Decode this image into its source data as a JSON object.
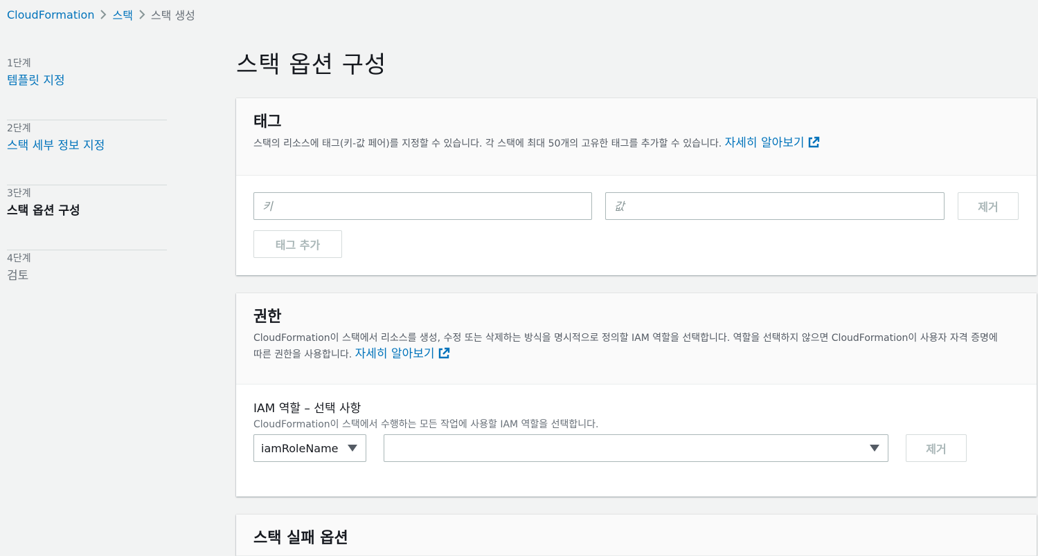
{
  "breadcrumb": {
    "items": [
      "CloudFormation",
      "스택",
      "스택 생성"
    ]
  },
  "steps": [
    {
      "num": "1단계",
      "label": "템플릿 지정"
    },
    {
      "num": "2단계",
      "label": "스택 세부 정보 지정"
    },
    {
      "num": "3단계",
      "label": "스택 옵션 구성"
    },
    {
      "num": "4단계",
      "label": "검토"
    }
  ],
  "page_title": "스택 옵션 구성",
  "tags_panel": {
    "title": "태그",
    "description": "스택의 리소스에 태그(키-값 페어)를 지정할 수 있습니다. 각 스택에 최대 50개의 고유한 태그를 추가할 수 있습니다.",
    "learn_more": "자세히 알아보기",
    "key_placeholder": "키",
    "value_placeholder": "값",
    "remove_label": "제거",
    "add_tag_label": "태그 추가"
  },
  "permissions_panel": {
    "title": "권한",
    "description": "CloudFormation이 스택에서 리소스를 생성, 수정 또는 삭제하는 방식을 명시적으로 정의할 IAM 역할을 선택합니다. 역할을 선택하지 않으면 CloudFormation이 사용자 자격 증명에 따른 권한을 사용합니다.",
    "learn_more": "자세히 알아보기",
    "iam_label": "IAM 역할 – 선택 사항",
    "iam_desc": "CloudFormation이 스택에서 수행하는 모든 작업에 사용할 IAM 역할을 선택합니다.",
    "role_type_value": "iamRoleName",
    "role_value": "",
    "remove_label": "제거"
  },
  "failure_panel": {
    "title": "스택 실패 옵션"
  },
  "colors": {
    "link": "#0073bb",
    "background": "#f2f3f3",
    "disabled_text": "#aab7b8"
  }
}
